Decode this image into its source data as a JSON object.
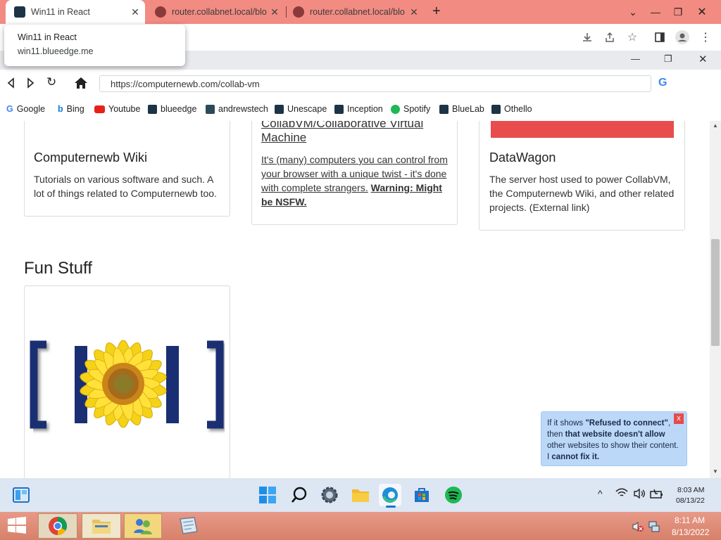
{
  "outer_browser": {
    "tabs": [
      {
        "label": "Win11 in React",
        "active": true
      },
      {
        "label": "router.collabnet.local/blo",
        "active": false
      },
      {
        "label": "router.collabnet.local/blo",
        "active": false
      }
    ],
    "new_tab_symbol": "+"
  },
  "tooltip": {
    "title": "Win11 in React",
    "url": "win11.blueedge.me"
  },
  "inner_browser": {
    "url": "https://computernewb.com/collab-vm",
    "bookmarks": [
      {
        "label": "Google",
        "color": "#4285f4"
      },
      {
        "label": "Bing",
        "color": "#0f7dd8"
      },
      {
        "label": "Youtube",
        "color": "#e62117"
      },
      {
        "label": "blueedge",
        "color": "#1d3447"
      },
      {
        "label": "andrewstech",
        "color": "#2b4a5a"
      },
      {
        "label": "Unescape",
        "color": "#1d3447"
      },
      {
        "label": "Inception",
        "color": "#1d3447"
      },
      {
        "label": "Spotify",
        "color": "#1db954"
      },
      {
        "label": "BlueLab",
        "color": "#1d3447"
      },
      {
        "label": "Othello",
        "color": "#1d3447"
      }
    ]
  },
  "page": {
    "cards": [
      {
        "title": "Computernewb Wiki",
        "text": "Tutorials on various software and such. A lot of things related to Computernewb too."
      },
      {
        "title": "CollabVM/Collaborative Virtual Machine",
        "text": "It's (many) computers you can control from your browser with a unique twist - it's done with complete strangers.",
        "warning": "Warning: Might be NSFW."
      },
      {
        "title": "DataWagon",
        "text": "The server host used to power CollabVM, the Computernewb Wiki, and other related projects. (External link)"
      }
    ],
    "section_title": "Fun Stuff"
  },
  "toast": {
    "text_1": "If it shows ",
    "bold_1": "\"Refused to connect\"",
    "text_2": ", then ",
    "bold_2": "that website doesn't allow",
    "text_3": " other websites to show their content. I ",
    "bold_3": "cannot fix it.",
    "close_label": "x"
  },
  "win11_taskbar": {
    "time": "8:03 AM",
    "date": "08/13/22"
  },
  "xp_taskbar": {
    "time": "8:11 AM",
    "date": "8/13/2022"
  },
  "colors": {
    "tabbar": "#f28b82",
    "datawagon_banner": "#e84c4c",
    "toast_bg": "#bcd8f8"
  }
}
